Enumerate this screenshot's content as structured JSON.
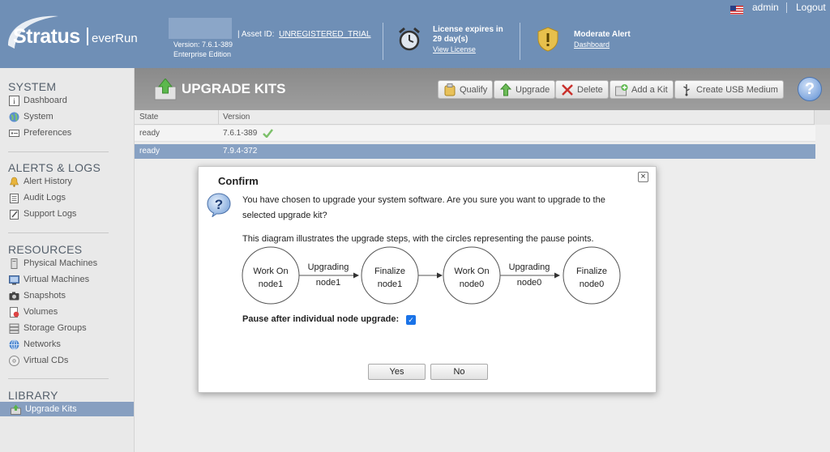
{
  "header": {
    "logo_text": "Stratus",
    "logo_sub": "everRun",
    "version": "Version: 7.6.1-389",
    "edition": "Enterprise Edition",
    "asset_label": "| Asset ID:",
    "asset_id": "UNREGISTERED_TRIAL",
    "license_title": "License expires in",
    "license_days": "29 day(s)",
    "license_link": "View License",
    "alert_title": "Moderate Alert",
    "alert_link": "Dashboard",
    "user": "admin",
    "logout": "Logout"
  },
  "sidebar": {
    "system_title": "SYSTEM",
    "system_items": [
      {
        "label": "Dashboard",
        "icon": "info-icon"
      },
      {
        "label": "System",
        "icon": "globe-icon"
      },
      {
        "label": "Preferences",
        "icon": "preferences-icon"
      }
    ],
    "alerts_title": "ALERTS & LOGS",
    "alerts_items": [
      {
        "label": "Alert History",
        "icon": "bell-icon"
      },
      {
        "label": "Audit Logs",
        "icon": "clipboard-icon"
      },
      {
        "label": "Support Logs",
        "icon": "pencil-icon"
      }
    ],
    "resources_title": "RESOURCES",
    "resources_items": [
      {
        "label": "Physical Machines",
        "icon": "server-icon"
      },
      {
        "label": "Virtual Machines",
        "icon": "vm-icon"
      },
      {
        "label": "Snapshots",
        "icon": "camera-icon"
      },
      {
        "label": "Volumes",
        "icon": "volume-icon"
      },
      {
        "label": "Storage Groups",
        "icon": "storage-icon"
      },
      {
        "label": "Networks",
        "icon": "network-icon"
      },
      {
        "label": "Virtual CDs",
        "icon": "cd-icon"
      }
    ],
    "library_title": "LIBRARY",
    "library_items": [
      {
        "label": "Upgrade Kits",
        "icon": "upgrade-kit-icon",
        "active": true
      }
    ]
  },
  "main": {
    "title": "UPGRADE KITS",
    "toolbar": {
      "qualify": "Qualify",
      "upgrade": "Upgrade",
      "delete": "Delete",
      "add_kit": "Add a Kit",
      "create_usb": "Create USB Medium",
      "help": "?"
    },
    "grid": {
      "columns": [
        "State",
        "Version"
      ],
      "rows": [
        {
          "state": "ready",
          "version": "7.6.1-389",
          "current": true
        },
        {
          "state": "ready",
          "version": "7.9.4-372",
          "selected": true
        }
      ]
    }
  },
  "dialog": {
    "title": "Confirm",
    "close": "×",
    "message_line1": "You have chosen to upgrade your system software. Are you sure you want to upgrade to the",
    "message_line2": "selected upgrade kit?",
    "diagram_caption": "This diagram illustrates the upgrade steps, with the circles representing the pause points.",
    "steps": [
      {
        "line1": "Work On",
        "line2": "node1"
      },
      {
        "line1": "Finalize",
        "line2": "node1"
      },
      {
        "line1": "Work On",
        "line2": "node0"
      },
      {
        "line1": "Finalize",
        "line2": "node0"
      }
    ],
    "arrows": [
      {
        "line1": "Upgrading",
        "line2": "node1"
      },
      {
        "line1": "",
        "line2": ""
      },
      {
        "line1": "Upgrading",
        "line2": "node0"
      }
    ],
    "pause_label": "Pause after individual node upgrade:",
    "pause_checked": true,
    "yes": "Yes",
    "no": "No"
  },
  "colors": {
    "header_bg": "#6f8fb6",
    "selected_row": "#87a1c3",
    "checkbox": "#1a73e8"
  }
}
